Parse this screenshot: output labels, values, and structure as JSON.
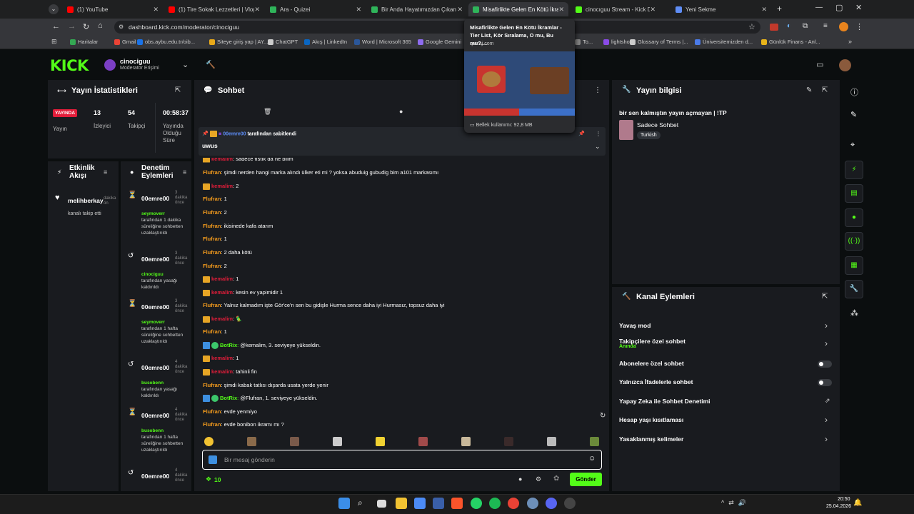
{
  "browser": {
    "tabs": [
      {
        "title": "(1) YouTube",
        "color": "#ff0000"
      },
      {
        "title": "(1) Tire Sokak Lezzetleri | Vlog",
        "color": "#ff0000"
      },
      {
        "title": "Ara - Quizei",
        "color": "#2fb45a"
      },
      {
        "title": "Bir Anda Hayatımızdan Çıkan",
        "color": "#2fb45a"
      },
      {
        "title": "Misafirlikte Gelen En Kötü İkram",
        "color": "#2fb45a"
      },
      {
        "title": "cinocıguu Stream - Kick Dashb",
        "color": "#53fc18"
      },
      {
        "title": "Yeni Sekme",
        "color": "#5f8df5"
      }
    ],
    "url": "dashboard.kick.com/moderator/cinociguu",
    "bookmarks": [
      "Haritalar",
      "Gmail",
      "obs.aybu.edu.tr/oib...",
      "Siteye giriş yap | AY...",
      "ChatGPT",
      "Akış | LinkedIn",
      "Word | Microsoft 365",
      "Google Gemini",
      "To...",
      "lightshot",
      "Glossary of Terms |...",
      "Üniversitemizden d...",
      "Günlük Finans - Anl..."
    ],
    "tooltip": {
      "title": "Misafirlikte Gelen En Kötü İkramlar - Tier List, Kör Sıralama, O mu, Bu mu?,...",
      "domain": "quizei.com",
      "memory": "Bellek kullanımı: 92,8 MB"
    }
  },
  "header": {
    "logo": "KICK",
    "channel": "cinociguu",
    "role": "Moderatör Erişimi"
  },
  "stats": {
    "title": "Yayın İstatistikleri",
    "live_badge": "YAYINDA",
    "live_label": "Yayın",
    "viewers": "13",
    "viewers_label": "İzleyici",
    "followers": "54",
    "followers_label": "Takipçi",
    "uptime": "00:58:37",
    "uptime_label": "Yayında Olduğu Süre"
  },
  "activity": {
    "title": "Etkinlik Akışı",
    "item_user": "melihberkay",
    "item_text": "kanalı takip etti",
    "item_time": "dakika ön"
  },
  "modlog": {
    "title": "Denetim Eylemleri",
    "entries": [
      {
        "icon": "⏳",
        "user": "00emre00",
        "by": "seymoverr",
        "text": "tarafından 1 dakika süreliğine sohbetten uzaklaştırıldı",
        "time": "3 dakika önce"
      },
      {
        "icon": "↺",
        "user": "00emre00",
        "by": "cinociguu",
        "text": "tarafından yasağı kaldırıldı",
        "time": "3 dakika önce"
      },
      {
        "icon": "⏳",
        "user": "00emre00",
        "by": "seymoverr",
        "text": "tarafından 1 hafta süreliğine sohbetten uzaklaştırıldı",
        "time": "3 dakika önce"
      },
      {
        "icon": "↺",
        "user": "00emre00",
        "by": "busobenn",
        "text": "tarafından yasağı kaldırıldı",
        "time": "4 dakika önce"
      },
      {
        "icon": "⏳",
        "user": "00emre00",
        "by": "busobenn",
        "text": "tarafından 1 hafta süreliğine sohbetten uzaklaştırıldı",
        "time": "4 dakika önce"
      },
      {
        "icon": "↺",
        "user": "00emre00",
        "by": "",
        "text": "",
        "time": "4 dakika önce"
      }
    ]
  },
  "chat": {
    "title": "Sohbet",
    "pinned_user": "00emre00",
    "pinned_by": "tarafından sabitlendi",
    "pinned_text": "uwus",
    "messages": [
      {
        "user": "kemalim",
        "color": "r",
        "badge": "crown",
        "text": "sadece fıstık da ne bilim"
      },
      {
        "user": "Flufran",
        "color": "o",
        "badge": "",
        "text": "şimdi nerden hangi marka alındı ülker eti mi ? yoksa abuduig gubudig bim a101 markasımı"
      },
      {
        "user": "kemalim",
        "color": "r",
        "badge": "crown",
        "text": "2"
      },
      {
        "user": "Flufran",
        "color": "o",
        "badge": "",
        "text": "1"
      },
      {
        "user": "Flufran",
        "color": "o",
        "badge": "",
        "text": "2"
      },
      {
        "user": "Flufran",
        "color": "o",
        "badge": "",
        "text": "ikisinede kafa atarım"
      },
      {
        "user": "Flufran",
        "color": "o",
        "badge": "",
        "text": "1"
      },
      {
        "user": "Flufran",
        "color": "o",
        "badge": "",
        "text": "2 daha kötü"
      },
      {
        "user": "Flufran",
        "color": "o",
        "badge": "",
        "text": "2"
      },
      {
        "user": "kemalim",
        "color": "r",
        "badge": "crown",
        "text": "1"
      },
      {
        "user": "kemalim",
        "color": "r",
        "badge": "crown",
        "text": "kesin ev yapimidir 1"
      },
      {
        "user": "Flufran",
        "color": "o",
        "badge": "",
        "text": "Yalnız kalmadım işte Gör'ce'n sen bu gidişle Hurma sence daha iyi Hurmasız, topsuz daha iyi"
      },
      {
        "user": "kemalim",
        "color": "r",
        "badge": "crown",
        "text": "🦜"
      },
      {
        "user": "Flufran",
        "color": "o",
        "badge": "",
        "text": "1"
      },
      {
        "user": "BotRix",
        "color": "g",
        "badge": "bot",
        "text": "@kemalim, 3. seviyeye yükseldin."
      },
      {
        "user": "kemalim",
        "color": "r",
        "badge": "crown",
        "text": "1"
      },
      {
        "user": "kemalim",
        "color": "r",
        "badge": "crown",
        "text": "tahinli fin"
      },
      {
        "user": "Flufran",
        "color": "o",
        "badge": "",
        "text": "şimdi kabak tatlısı dışarda usata yerde yenir"
      },
      {
        "user": "BotRix",
        "color": "g",
        "badge": "bot",
        "text": "@Flufran, 1. seviyeye yükseldin."
      },
      {
        "user": "Flufran",
        "color": "o",
        "badge": "",
        "text": "evde yenmiyo"
      },
      {
        "user": "Flufran",
        "color": "o",
        "badge": "",
        "text": "evde bonibon ikramı mı ?"
      }
    ],
    "placeholder": "Bir mesaj gönderin",
    "points": "10",
    "send": "Gönder"
  },
  "streaminfo": {
    "title": "Yayın bilgisi",
    "stream_title": "bir sen kalmıştın yayın açmayan | !TP",
    "category": "Sadece Sohbet",
    "tag": "Turkish"
  },
  "actions": {
    "title": "Kanal Eylemleri",
    "items": [
      {
        "label": "Yavaş mod",
        "sub": "",
        "control": "chevron"
      },
      {
        "label": "Takipçilere özel sohbet",
        "sub": "Anında",
        "control": "chevron"
      },
      {
        "label": "Abonelere özel sohbet",
        "sub": "",
        "control": "toggle"
      },
      {
        "label": "Yalnızca İfadelerle sohbet",
        "sub": "",
        "control": "toggle"
      },
      {
        "label": "Yapay Zeka ile Sohbet Denetimi",
        "sub": "",
        "control": "external"
      },
      {
        "label": "Hesap yaşı kısıtlaması",
        "sub": "",
        "control": "chevron"
      },
      {
        "label": "Yasaklanmış kelimeler",
        "sub": "",
        "control": "chevron"
      }
    ]
  },
  "taskbar": {
    "time": "20:50",
    "date": "25.04.2026"
  },
  "colors": {
    "accent": "#53fc18",
    "panel": "#191b1f",
    "bg": "#0b0e0f"
  }
}
